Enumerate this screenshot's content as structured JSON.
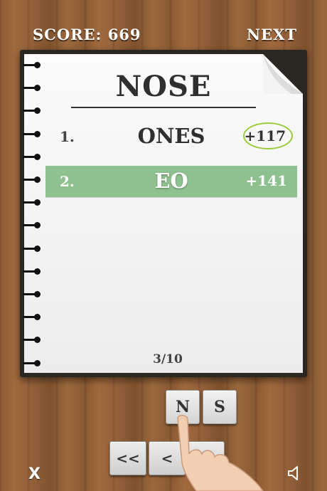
{
  "header": {
    "score_text": "SCORE: 669",
    "next_label": "NEXT"
  },
  "puzzle": {
    "word": "NOSE"
  },
  "answers": [
    {
      "number": "1.",
      "word": "ONES",
      "points": "+117",
      "circled": true
    },
    {
      "number": "2.",
      "word": "EO",
      "points": "+141",
      "highlighted": true
    }
  ],
  "pager": {
    "text": "3/10"
  },
  "tiles": [
    "N",
    "S"
  ],
  "nav": {
    "first_label": "<<",
    "prev_label": "<",
    "next_label": ">>"
  },
  "footer": {
    "close_label": "X",
    "sound_icon": "speaker-icon"
  },
  "colors": {
    "highlight": "#8fc08f",
    "circle": "#9ccb3a"
  }
}
